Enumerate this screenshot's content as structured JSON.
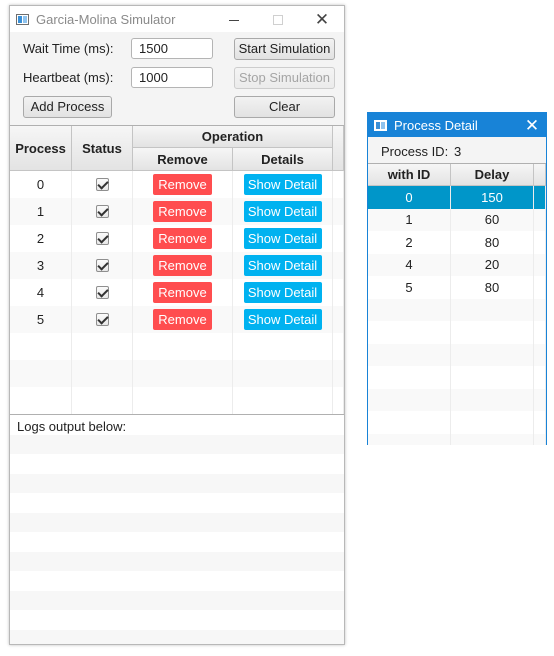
{
  "main_window": {
    "title": "Garcia-Molina Simulator",
    "form": {
      "wait_time_label": "Wait Time (ms):",
      "wait_time_value": "1500",
      "heartbeat_label": "Heartbeat (ms):",
      "heartbeat_value": "1000"
    },
    "buttons": {
      "start": "Start Simulation",
      "stop": "Stop Simulation",
      "add": "Add Process",
      "clear": "Clear"
    },
    "table": {
      "headers": {
        "process": "Process",
        "status": "Status",
        "operation": "Operation",
        "remove": "Remove",
        "details": "Details"
      },
      "rows": [
        {
          "process": "0",
          "checked": true,
          "remove_label": "Remove",
          "detail_label": "Show Detail"
        },
        {
          "process": "1",
          "checked": true,
          "remove_label": "Remove",
          "detail_label": "Show Detail"
        },
        {
          "process": "2",
          "checked": true,
          "remove_label": "Remove",
          "detail_label": "Show Detail"
        },
        {
          "process": "3",
          "checked": true,
          "remove_label": "Remove",
          "detail_label": "Show Detail"
        },
        {
          "process": "4",
          "checked": true,
          "remove_label": "Remove",
          "detail_label": "Show Detail"
        },
        {
          "process": "5",
          "checked": true,
          "remove_label": "Remove",
          "detail_label": "Show Detail"
        }
      ]
    },
    "logs": {
      "label": "Logs output below:"
    },
    "colors": {
      "remove_button": "#ff4d4f",
      "detail_button": "#00b2f0"
    }
  },
  "detail_window": {
    "title": "Process Detail",
    "process_id_label": "Process ID:",
    "process_id_value": "3",
    "headers": {
      "with_id": "with ID",
      "delay": "Delay"
    },
    "rows": [
      {
        "with_id": "0",
        "delay": "150",
        "selected": true
      },
      {
        "with_id": "1",
        "delay": "60",
        "selected": false
      },
      {
        "with_id": "2",
        "delay": "80",
        "selected": false
      },
      {
        "with_id": "4",
        "delay": "20",
        "selected": false
      },
      {
        "with_id": "5",
        "delay": "80",
        "selected": false
      }
    ],
    "colors": {
      "titlebar": "#1883d7",
      "selected_row": "#0096c9"
    }
  }
}
